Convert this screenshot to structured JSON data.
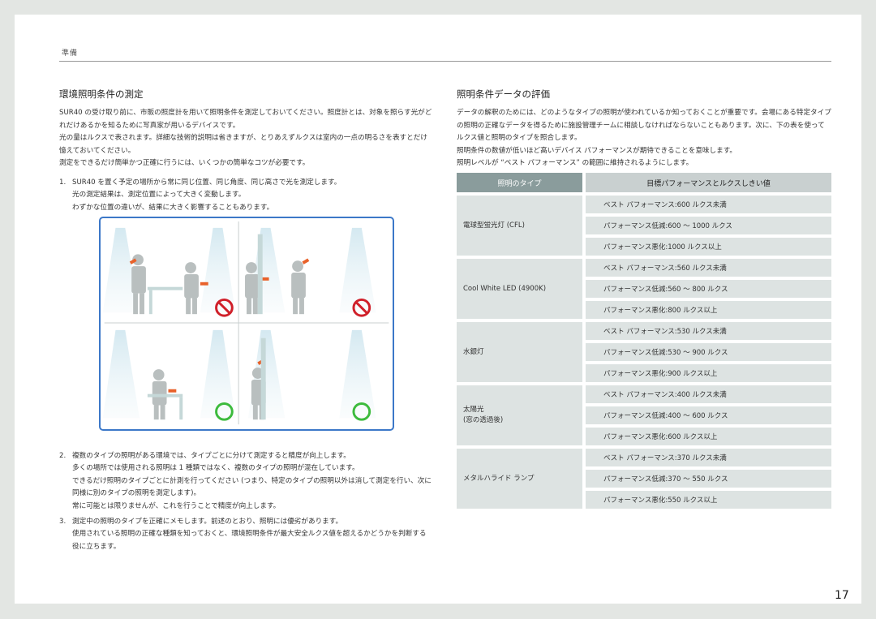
{
  "header": {
    "section": "準備"
  },
  "left": {
    "title": "環境照明条件の測定",
    "paragraphs": [
      "SUR40 の受け取り前に、市販の照度計を用いて照明条件を測定しておいてください。照度計とは、対象を照らす光がどれだけあるかを知るために写真家が用いるデバイスです。",
      "光の量はルクスで表されます。詳細な技術的説明は省きますが、とりあえずルクスは室内の一点の明るさを表すとだけ憶えておいてください。",
      "測定をできるだけ簡単かつ正確に行うには、いくつかの簡単なコツが必要です。"
    ],
    "steps": [
      {
        "num": "1.",
        "lines": [
          "SUR40 を置く予定の場所から常に同じ位置、同じ角度、同じ高さで光を測定します。",
          "光の測定結果は、測定位置によって大きく変動します。",
          "わずかな位置の違いが、結果に大きく影響することもあります。"
        ]
      },
      {
        "num": "2.",
        "lines": [
          "複数のタイプの照明がある環境では、タイプごとに分けて測定すると精度が向上します。",
          "多くの場所では使用される照明は 1 種類ではなく、複数のタイプの照明が混在しています。",
          "できるだけ照明のタイプごとに計測を行ってください (つまり、特定のタイプの照明以外は消して測定を行い、次に同様に別のタイプの照明を測定します)。",
          "常に可能とは限りませんが、これを行うことで精度が向上します。"
        ]
      },
      {
        "num": "3.",
        "lines": [
          "測定中の照明のタイプを正確にメモします。前述のとおり、照明には優劣があります。",
          "使用されている照明の正確な種類を知っておくと、環境照明条件が最大安全ルクス値を超えるかどうかを判断する役に立ちます。"
        ]
      }
    ]
  },
  "right": {
    "title": "照明条件データの評価",
    "paragraphs": [
      "データの解釈のためには、どのようなタイプの照明が使われているか知っておくことが重要です。会場にある特定タイプの照明の正確なデータを得るために施設管理チームに相談しなければならないこともあります。次に、下の表を使ってルクス値と照明のタイプを照合します。",
      "照明条件の数値が低いほど高いデバイス パフォーマンスが期待できることを意味します。",
      "照明レベルが “ベスト パフォーマンス” の範囲に維持されるようにします。"
    ]
  },
  "table": {
    "header": [
      "照明のタイプ",
      "目標パフォーマンスとルクスしきい値"
    ],
    "groups": [
      {
        "type": "電球型蛍光灯 (CFL)",
        "values": [
          "ベスト パフォーマンス:600 ルクス未満",
          "パフォーマンス低減:600 ～ 1000 ルクス",
          "パフォーマンス悪化:1000 ルクス以上"
        ]
      },
      {
        "type": "Cool White LED (4900K)",
        "values": [
          "ベスト パフォーマンス:560 ルクス未満",
          "パフォーマンス低減:560 ～ 800 ルクス",
          "パフォーマンス悪化:800 ルクス以上"
        ]
      },
      {
        "type": "水銀灯",
        "values": [
          "ベスト パフォーマンス:530 ルクス未満",
          "パフォーマンス低減:530 ～ 900 ルクス",
          "パフォーマンス悪化:900 ルクス以上"
        ]
      },
      {
        "type": "太陽光",
        "type2": "(窓の透過後)",
        "values": [
          "ベスト パフォーマンス:400 ルクス未満",
          "パフォーマンス低減:400 ～ 600 ルクス",
          "パフォーマンス悪化:600 ルクス以上"
        ]
      },
      {
        "type": "メタルハライド ランプ",
        "values": [
          "ベスト パフォーマンス:370 ルクス未満",
          "パフォーマンス低減:370 ～ 550 ルクス",
          "パフォーマンス悪化:550 ルクス以上"
        ]
      }
    ]
  },
  "figure": {
    "panels": [
      "incorrect",
      "incorrect",
      "correct",
      "correct"
    ],
    "colors": {
      "border": "#3c78c8",
      "no": "#d0202a",
      "ok": "#3dbb3d",
      "meter": "#e8612a"
    }
  },
  "footer": {
    "page_number": "17"
  }
}
